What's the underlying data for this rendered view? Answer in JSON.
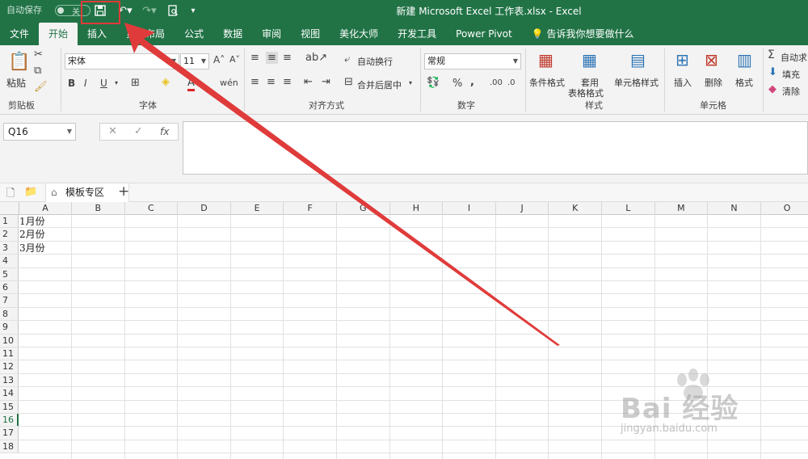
{
  "quick_access": {
    "autosave_label": "自动保存",
    "autosave_state": "关"
  },
  "window_title": "新建 Microsoft Excel 工作表.xlsx  -  Excel",
  "tabs": [
    {
      "label": "文件"
    },
    {
      "label": "开始"
    },
    {
      "label": "插入"
    },
    {
      "label": "页面布局"
    },
    {
      "label": "公式"
    },
    {
      "label": "数据"
    },
    {
      "label": "审阅"
    },
    {
      "label": "视图"
    },
    {
      "label": "美化大师"
    },
    {
      "label": "开发工具"
    },
    {
      "label": "Power Pivot"
    },
    {
      "label": "告诉我你想要做什么"
    }
  ],
  "ribbon": {
    "clipboard": {
      "paste": "粘贴",
      "label": "剪贴板"
    },
    "font": {
      "name": "宋体",
      "size": "11",
      "bold": "B",
      "italic": "I",
      "underline": "U",
      "color_letter": "A",
      "label": "字体"
    },
    "align": {
      "wrap": "自动换行",
      "merge": "合并后居中",
      "label": "对齐方式"
    },
    "number": {
      "format": "常规",
      "percent": "%",
      "comma": ",",
      "label": "数字"
    },
    "styles": {
      "cond": "条件格式",
      "table1": "套用",
      "table2": "表格格式",
      "cell": "单元格样式",
      "label": "样式"
    },
    "cells": {
      "insert": "插入",
      "delete": "删除",
      "format": "格式",
      "label": "单元格"
    },
    "editing": {
      "autosum": "自动求",
      "fill": "填充",
      "clear": "清除"
    }
  },
  "formula_bar": {
    "name_box": "Q16",
    "fx": "fx"
  },
  "sheet_tabs": {
    "template": "模板专区",
    "add": "+"
  },
  "columns": [
    "A",
    "B",
    "C",
    "D",
    "E",
    "F",
    "G",
    "H",
    "I",
    "J",
    "K",
    "L",
    "M",
    "N",
    "O"
  ],
  "rows": [
    "1",
    "2",
    "3",
    "4",
    "5",
    "6",
    "7",
    "8",
    "9",
    "10",
    "11",
    "12",
    "13",
    "14",
    "15",
    "16",
    "17",
    "18"
  ],
  "cells_a": [
    "1月份",
    "2月份",
    "3月份",
    "",
    "",
    "",
    "",
    "",
    "",
    "",
    "",
    "",
    "",
    "",
    "",
    "",
    "",
    ""
  ],
  "watermark": {
    "brand": "Bai 经验",
    "url": "jingyan.baidu.com"
  },
  "colors": {
    "accent": "#217346",
    "annotation": "#e03b3b"
  }
}
